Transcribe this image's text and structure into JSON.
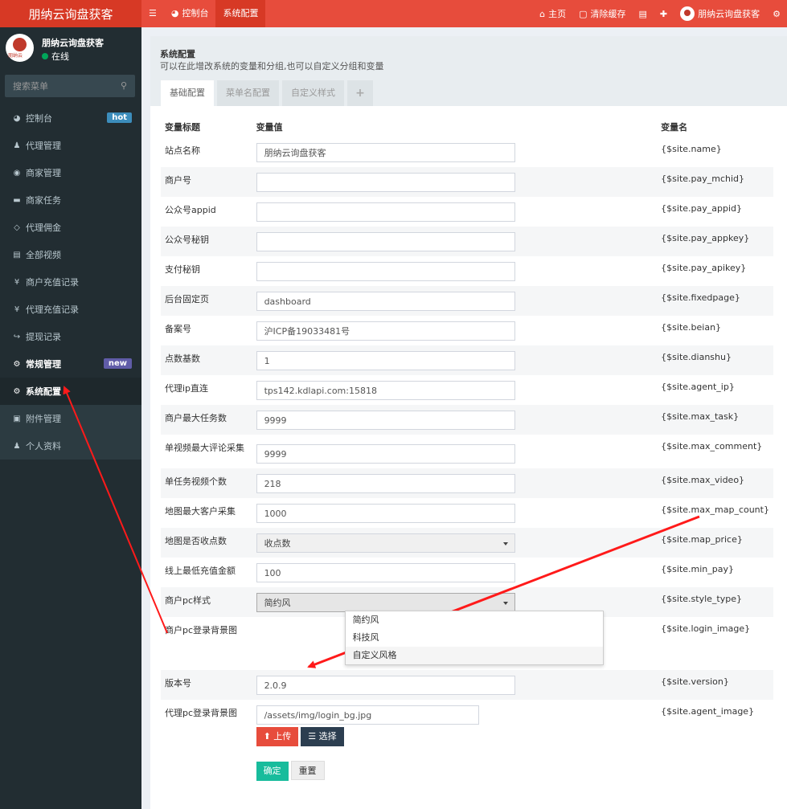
{
  "brand": {
    "title": "朋纳云询盘获客"
  },
  "topnav": {
    "menu_icon": "bars-icon",
    "items": [
      {
        "label": "控制台",
        "icon": "dashboard-icon"
      },
      {
        "label": "系统配置"
      }
    ]
  },
  "topright": {
    "home": "主页",
    "clear_cache": "清除缓存",
    "user": "朋纳云询盘获客"
  },
  "sidebar": {
    "user_name": "朋纳云询盘获客",
    "status": "在线",
    "avatar_text": "朋纳云",
    "search_placeholder": "搜索菜单",
    "items": [
      {
        "label": "控制台",
        "badge": "hot"
      },
      {
        "label": "代理管理"
      },
      {
        "label": "商家管理"
      },
      {
        "label": "商家任务"
      },
      {
        "label": "代理佣金"
      },
      {
        "label": "全部视频"
      },
      {
        "label": "商户充值记录"
      },
      {
        "label": "代理充值记录"
      },
      {
        "label": "提现记录"
      },
      {
        "label": "常规管理",
        "badge": "new"
      },
      {
        "label": "系统配置"
      },
      {
        "label": "附件管理"
      },
      {
        "label": "个人资料"
      }
    ]
  },
  "panel": {
    "title": "系统配置",
    "description": "可以在此增改系统的变量和分组,也可以自定义分组和变量",
    "tabs": [
      "基础配置",
      "菜单名配置",
      "自定义样式",
      "+"
    ]
  },
  "table": {
    "headers": [
      "变量标题",
      "变量值",
      "变量名"
    ],
    "rows": [
      {
        "title": "站点名称",
        "value": "朋纳云询盘获客",
        "var": "{$site.name}"
      },
      {
        "title": "商户号",
        "value": "",
        "var": "{$site.pay_mchid}"
      },
      {
        "title": "公众号appid",
        "value": "",
        "var": "{$site.pay_appid}"
      },
      {
        "title": "公众号秘钥",
        "value": "",
        "var": "{$site.pay_appkey}"
      },
      {
        "title": "支付秘钥",
        "value": "",
        "var": "{$site.pay_apikey}"
      },
      {
        "title": "后台固定页",
        "value": "dashboard",
        "var": "{$site.fixedpage}"
      },
      {
        "title": "备案号",
        "value": "沪ICP备19033481号",
        "var": "{$site.beian}"
      },
      {
        "title": "点数基数",
        "value": "1",
        "var": "{$site.dianshu}"
      },
      {
        "title": "代理ip直连",
        "value": "tps142.kdlapi.com:15818",
        "var": "{$site.agent_ip}"
      },
      {
        "title": "商户最大任务数",
        "value": "9999",
        "var": "{$site.max_task}"
      },
      {
        "title": "单视频最大评论采集",
        "value": "9999",
        "var": "{$site.max_comment}"
      },
      {
        "title": "单任务视频个数",
        "value": "218",
        "var": "{$site.max_video}"
      },
      {
        "title": "地图最大客户采集",
        "value": "1000",
        "var": "{$site.max_map_count}"
      },
      {
        "title": "地图是否收点数",
        "value": "收点数",
        "var": "{$site.map_price}"
      },
      {
        "title": "线上最低充值金额",
        "value": "100",
        "var": "{$site.min_pay}"
      },
      {
        "title": "商户pc样式",
        "value": "简约风",
        "var": "{$site.style_type}"
      },
      {
        "title": "商户pc登录背景图",
        "value": "",
        "var": "{$site.login_image}"
      },
      {
        "title": "版本号",
        "value": "2.0.9",
        "var": "{$site.version}"
      },
      {
        "title": "代理pc登录背景图",
        "value": "/assets/img/login_bg.jpg",
        "var": "{$site.agent_image}"
      }
    ],
    "style_options": [
      "简约风",
      "科技风",
      "自定义风格"
    ]
  },
  "buttons": {
    "upload": "上传",
    "choose": "选择",
    "confirm": "确定",
    "reset": "重置"
  },
  "colors": {
    "topbar": "#e74c3c",
    "sidebar": "#222d32",
    "accent_green": "#18bc9c",
    "annotation_red": "#ff1a1a"
  }
}
